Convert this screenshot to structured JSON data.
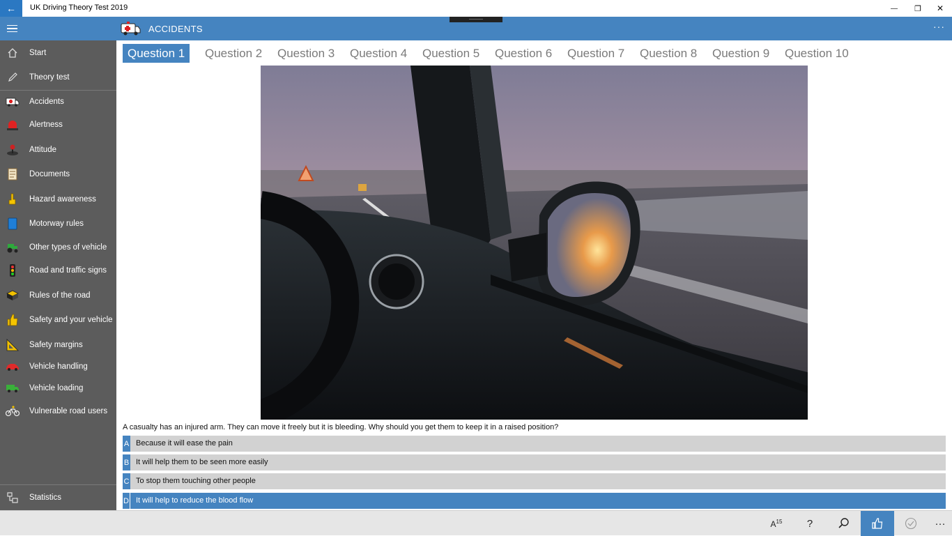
{
  "window": {
    "title": "UK Driving Theory Test 2019",
    "back_glyph": "←",
    "minimize_glyph": "—",
    "restore_glyph": "❐",
    "close_glyph": "✕"
  },
  "header": {
    "title": "ACCIDENTS",
    "more_glyph": "···",
    "icon": "ambulance-icon"
  },
  "sidebar": {
    "items": [
      {
        "label": "Start",
        "icon": "home-icon"
      },
      {
        "label": "Theory test",
        "icon": "pencil-icon"
      },
      {
        "label": "Accidents",
        "icon": "ambulance-icon"
      },
      {
        "label": "Alertness",
        "icon": "siren-icon"
      },
      {
        "label": "Attitude",
        "icon": "joystick-icon"
      },
      {
        "label": "Documents",
        "icon": "scroll-icon"
      },
      {
        "label": "Hazard awareness",
        "icon": "hand-icon"
      },
      {
        "label": "Motorway rules",
        "icon": "book-icon"
      },
      {
        "label": "Other types of vehicle",
        "icon": "tractor-icon"
      },
      {
        "label": "Road and traffic signs",
        "icon": "traffic-light-icon"
      },
      {
        "label": "Rules of the road",
        "icon": "package-icon"
      },
      {
        "label": "Safety and your vehicle",
        "icon": "thumbs-up-icon"
      },
      {
        "label": "Safety margins",
        "icon": "triangle-ruler-icon"
      },
      {
        "label": "Vehicle handling",
        "icon": "car-icon"
      },
      {
        "label": "Vehicle loading",
        "icon": "truck-icon"
      },
      {
        "label": "Vulnerable road users",
        "icon": "bicycle-icon"
      }
    ],
    "statistics": {
      "label": "Statistics",
      "icon": "statistics-icon"
    }
  },
  "tabs": [
    "Question 1",
    "Question 2",
    "Question 3",
    "Question 4",
    "Question 5",
    "Question 6",
    "Question 7",
    "Question 8",
    "Question 9",
    "Question 10"
  ],
  "active_tab": 0,
  "question": {
    "text": "A casualty has an injured arm. They can move it freely but it is bleeding. Why should you get them to keep it in a raised position?",
    "answers": [
      {
        "letter": "A",
        "text": "Because it will ease the pain",
        "selected": false
      },
      {
        "letter": "B",
        "text": "It will help them to be seen more easily",
        "selected": false
      },
      {
        "letter": "C",
        "text": "To stop them touching other people",
        "selected": false
      },
      {
        "letter": "D",
        "text": "It will help to reduce the blood flow",
        "selected": true
      }
    ]
  },
  "appbar": {
    "font_size_label": "A",
    "font_size_value": "15",
    "help_glyph": "?",
    "search_icon": "search-icon",
    "like_icon": "thumbs-up-icon",
    "check_icon": "check-circle-icon",
    "more_glyph": "···"
  },
  "colors": {
    "accent": "#4584c0",
    "sidebar": "#5c5c5c",
    "answer_bg": "#d2d2d2"
  }
}
